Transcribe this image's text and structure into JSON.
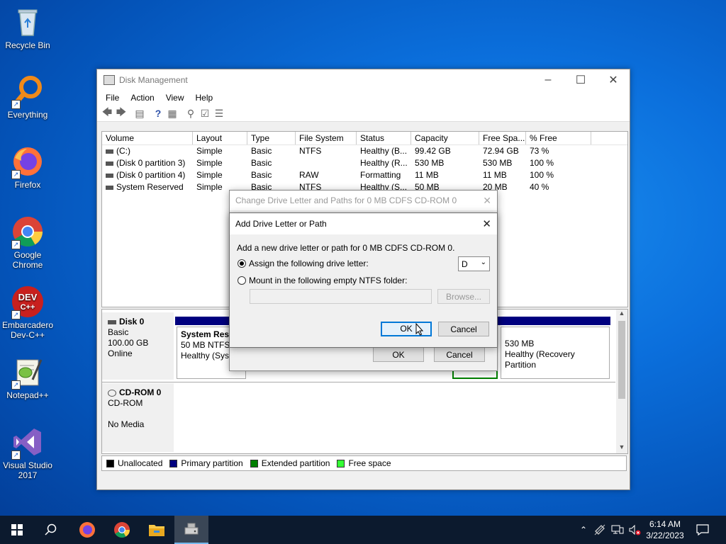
{
  "desktop": {
    "icons": [
      {
        "label": "Recycle Bin"
      },
      {
        "label": "Everything"
      },
      {
        "label": "Firefox"
      },
      {
        "label": "Google Chrome"
      },
      {
        "label": "Embarcadero Dev-C++"
      },
      {
        "label": "Notepad++"
      },
      {
        "label": "Visual Studio 2017"
      }
    ]
  },
  "window": {
    "title": "Disk Management",
    "menu": [
      "File",
      "Action",
      "View",
      "Help"
    ],
    "columns": [
      "Volume",
      "Layout",
      "Type",
      "File System",
      "Status",
      "Capacity",
      "Free Spa...",
      "% Free"
    ],
    "volumes": [
      {
        "volume": "(C:)",
        "layout": "Simple",
        "type": "Basic",
        "fs": "NTFS",
        "status": "Healthy (B...",
        "capacity": "99.42 GB",
        "free": "72.94 GB",
        "pct": "73 %"
      },
      {
        "volume": "(Disk 0 partition 3)",
        "layout": "Simple",
        "type": "Basic",
        "fs": "",
        "status": "Healthy (R...",
        "capacity": "530 MB",
        "free": "530 MB",
        "pct": "100 %"
      },
      {
        "volume": "(Disk 0 partition 4)",
        "layout": "Simple",
        "type": "Basic",
        "fs": "RAW",
        "status": "Formatting",
        "capacity": "11 MB",
        "free": "11 MB",
        "pct": "100 %"
      },
      {
        "volume": "System Reserved",
        "layout": "Simple",
        "type": "Basic",
        "fs": "NTFS",
        "status": "Healthy (S...",
        "capacity": "50 MB",
        "free": "20 MB",
        "pct": "40 %"
      }
    ],
    "disk0": {
      "name": "Disk 0",
      "type": "Basic",
      "size": "100.00 GB",
      "state": "Online"
    },
    "disk0_parts": {
      "sysres": {
        "name": "System Rese",
        "size": "50 MB NTFS",
        "status": "Healthy (Syst"
      },
      "recovery": {
        "size": "530 MB",
        "status": "Healthy (Recovery Partition"
      }
    },
    "cdrom": {
      "name": "CD-ROM 0",
      "type": "CD-ROM",
      "state": "No Media"
    },
    "legend": [
      {
        "label": "Unallocated",
        "color": "#000000"
      },
      {
        "label": "Primary partition",
        "color": "#00007f"
      },
      {
        "label": "Extended partition",
        "color": "#008000"
      },
      {
        "label": "Free space",
        "color": "#33ff33"
      }
    ]
  },
  "outer_dialog": {
    "title": "Change Drive Letter and Paths for 0 MB CDFS  CD-ROM 0",
    "ok": "OK",
    "cancel": "Cancel"
  },
  "dialog": {
    "title": "Add Drive Letter or Path",
    "description": "Add a new drive letter or path for 0 MB CDFS  CD-ROM 0.",
    "assign_label": "Assign the following drive letter:",
    "drive_letter": "D",
    "mount_label": "Mount in the following empty NTFS folder:",
    "folder_value": "",
    "browse": "Browse...",
    "ok": "OK",
    "cancel": "Cancel"
  },
  "taskbar": {
    "time": "6:14 AM",
    "date": "3/22/2023"
  }
}
